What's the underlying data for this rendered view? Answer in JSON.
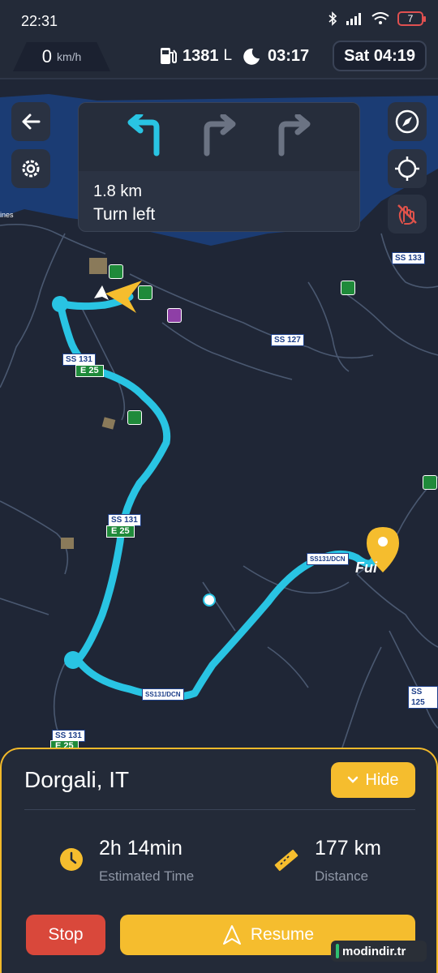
{
  "status_bar": {
    "time": "22:31",
    "battery": "7"
  },
  "info_bar": {
    "speed_value": "0",
    "speed_unit": "km/h",
    "fuel_value": "1381",
    "fuel_unit": "L",
    "rest_time": "03:17",
    "clock": "Sat 04:19"
  },
  "icons": {
    "back": "arrow-left-icon",
    "settings": "gear-icon",
    "compass": "compass-icon",
    "locate": "crosshair-icon",
    "gesture": "hand-gesture-icon",
    "fuel": "fuel-pump-icon",
    "rest": "moon-sleep-icon",
    "timer": "clock-icon",
    "distance": "ruler-icon",
    "resume": "navigation-arrow-icon",
    "hide": "chevron-down-icon"
  },
  "navigation": {
    "distance": "1.8 km",
    "instruction": "Turn left"
  },
  "map": {
    "road_labels": [
      "SS 133",
      "SS 127",
      "SS 131",
      "SS 131",
      "SS 131",
      "SS131/DCN",
      "SS131/DCN",
      "SS 125"
    ],
    "green_labels": [
      "E 25",
      "E 25",
      "E 25"
    ],
    "poi_label": "Fui",
    "place_fragment": "ines"
  },
  "trip": {
    "destination": "Dorgali, IT",
    "hide_label": "Hide",
    "estimated_time_value": "2h 14min",
    "estimated_time_label": "Estimated Time",
    "distance_value": "177 km",
    "distance_label": "Distance",
    "stop_label": "Stop",
    "resume_label": "Resume"
  },
  "watermark": "modindir.tr",
  "colors": {
    "accent": "#f5bd2e",
    "route": "#29c4e3",
    "stop": "#d9483b",
    "panel": "#232a38"
  }
}
